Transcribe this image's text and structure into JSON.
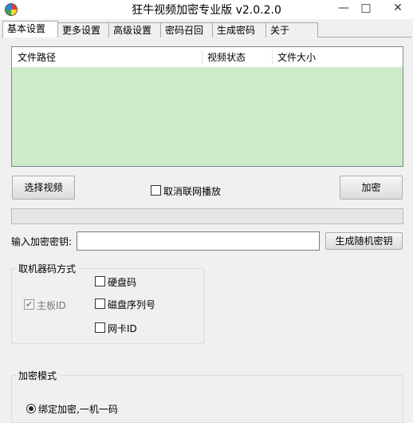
{
  "window": {
    "title": "狂牛视频加密专业版 v2.0.2.0",
    "minimize_glyph": "—",
    "maximize_glyph": "□",
    "close_glyph": "✕"
  },
  "tabs": [
    {
      "label": "基本设置",
      "active": true
    },
    {
      "label": "更多设置"
    },
    {
      "label": "高级设置"
    },
    {
      "label": "密码召回"
    },
    {
      "label": "生成密码"
    },
    {
      "label": "关于"
    }
  ],
  "file_list": {
    "columns": [
      "文件路径",
      "视频状态",
      "文件大小"
    ],
    "rows": []
  },
  "actions": {
    "select_video": "选择视频",
    "cancel_network_play": "取消联网播放",
    "cancel_network_play_checked": false,
    "encrypt": "加密"
  },
  "progress": {
    "value": 0
  },
  "key": {
    "label": "输入加密密钥:",
    "value": "",
    "generate_random": "生成随机密钥"
  },
  "machine_code": {
    "title": "取机器码方式",
    "options": [
      {
        "label": "主板ID",
        "checked": true,
        "disabled": true
      },
      {
        "label": "硬盘码",
        "checked": false
      },
      {
        "label": "磁盘序列号",
        "checked": false
      },
      {
        "label": "网卡ID",
        "checked": false
      }
    ]
  },
  "encrypt_mode": {
    "title": "加密模式",
    "options": [
      {
        "label": "绑定加密,一机一码",
        "selected": true
      }
    ]
  }
}
